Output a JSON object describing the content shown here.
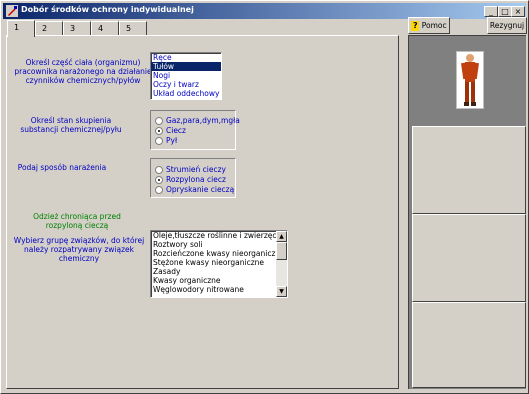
{
  "window": {
    "title": "Dobór środków ochrony indywidualnej"
  },
  "title_buttons": {
    "minimize": "_",
    "maximize": "□",
    "close": "×"
  },
  "tabs": [
    {
      "label": "1"
    },
    {
      "label": "2"
    },
    {
      "label": "3"
    },
    {
      "label": "4"
    },
    {
      "label": "5"
    }
  ],
  "toolbar": {
    "help_label": "Pomoc",
    "resign_label": "Rezygnuj"
  },
  "questions": {
    "body_part": "Określ część ciała (organizmu) pracownika narażonego na działanie czynników chemicznych/pyłów",
    "state": "Określ stan skupienia substancji chemicznej/pyłu",
    "exposure": "Podaj sposób narażenia",
    "protective_result": "Odzież chroniąca przed rozpyloną cieczą",
    "compound_group": "Wybierz grupę związków, do której należy rozpatrywany związek chemiczny"
  },
  "body_parts": {
    "items": [
      "Ręce",
      "Tułów",
      "Nogi",
      "Oczy i twarz",
      "Układ oddechowy"
    ],
    "selected_index": 1
  },
  "state_options": {
    "items": [
      "Gaz,para,dym,mgła",
      "Ciecz",
      "Pył"
    ],
    "selected_index": 1
  },
  "exposure_options": {
    "items": [
      "Strumień cieczy",
      "Rozpylona ciecz",
      "Opryskanie cieczą"
    ],
    "selected_index": 1
  },
  "compound_groups": {
    "items": [
      "Oleje,tłuszcze roślinne i zwierzęce",
      "Roztwory soli",
      "Rozcieńczone kwasy nieorganiczne",
      "Stężone kwasy nieorganiczne",
      "Zasady",
      "Kwasy organiczne",
      "Węglowodory nitrowane"
    ],
    "scroll_up": "▲",
    "scroll_down": "▼"
  },
  "colors": {
    "question_text": "#0000c0",
    "result_text": "#008000",
    "selection": "#0a246a"
  }
}
